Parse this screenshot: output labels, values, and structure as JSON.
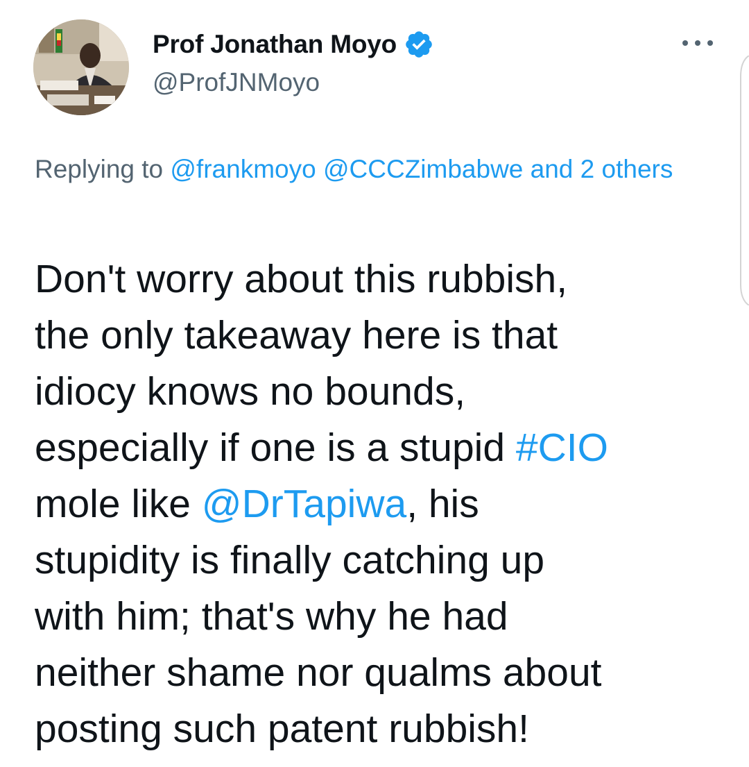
{
  "author": {
    "display_name": "Prof Jonathan Moyo",
    "handle": "@ProfJNMoyo",
    "verified_icon": "verified-badge-icon",
    "verified_color": "#1d9bf0"
  },
  "more_icon": "more-options-icon",
  "reply": {
    "prefix": "Replying to ",
    "mention_1": "@frankmoyo",
    "mention_2": "@CCCZimbabwe",
    "and_others": "and 2 others"
  },
  "tweet": {
    "line_1": "Don't worry about this rubbish,",
    "line_2": "the only takeaway here is that",
    "line_3": "idiocy knows no bounds,",
    "line_4_text": "especially if one is a stupid ",
    "line_4_hashtag": "#CIO",
    "line_5_text_a": "mole like ",
    "line_5_mention": "@DrTapiwa",
    "line_5_text_b": ", his",
    "line_6": "stupidity is finally catching up",
    "line_7": "with him; that's why he had",
    "line_8": "neither shame nor qualms about",
    "line_9": "posting such patent rubbish!"
  },
  "colors": {
    "text_primary": "#0f1419",
    "text_secondary": "#536471",
    "link": "#1d9bf0"
  }
}
